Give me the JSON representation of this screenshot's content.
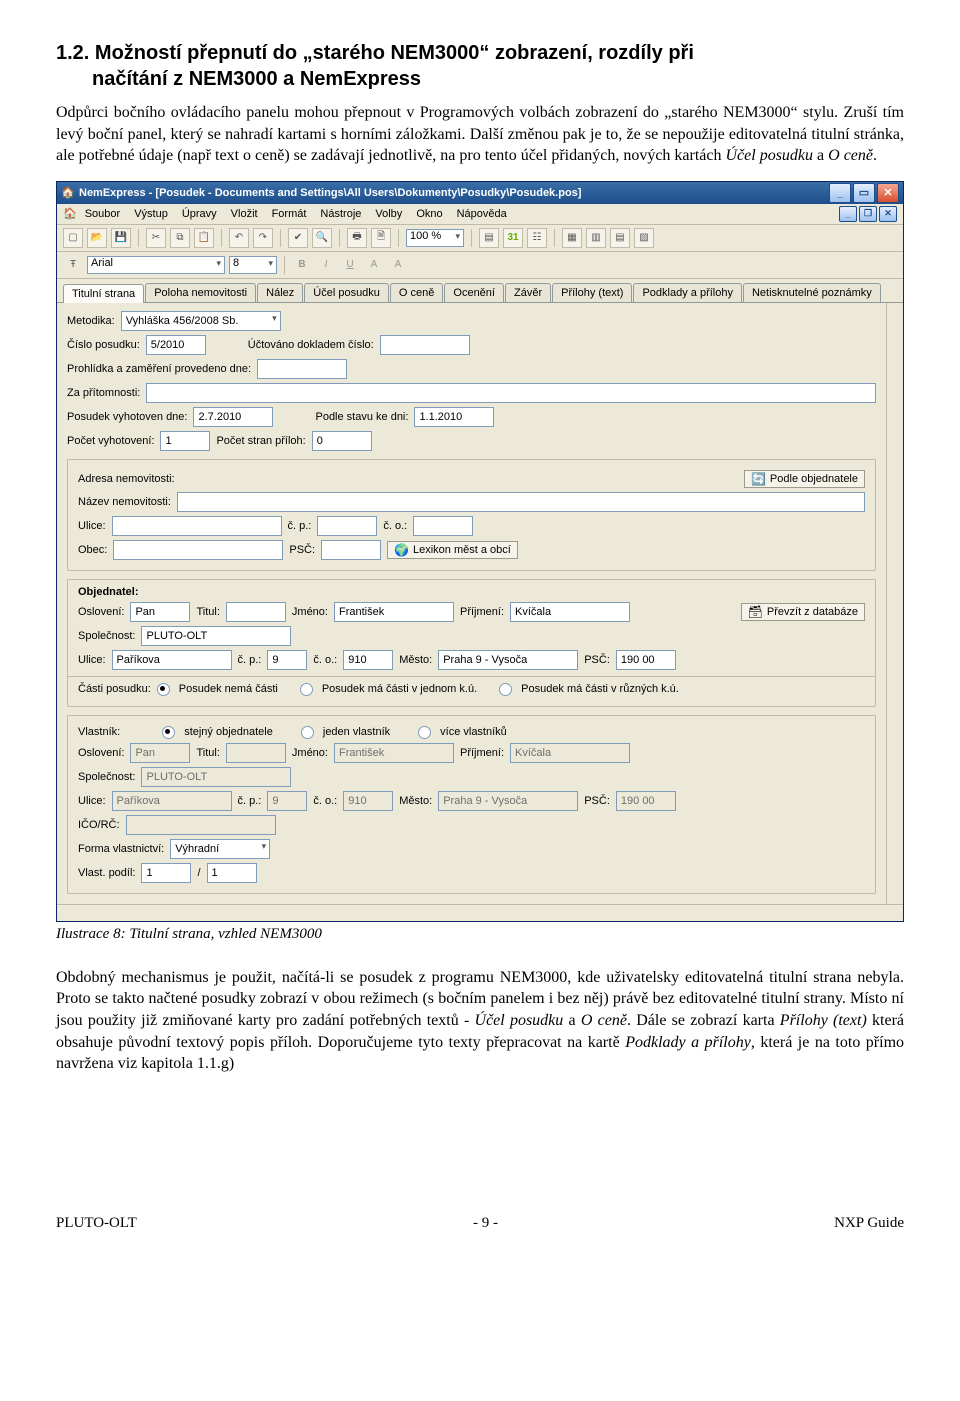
{
  "heading": {
    "number": "1.2.",
    "line1": "Možností přepnutí do „starého NEM3000“ zobrazení, rozdíly při",
    "line2": "načítání z NEM3000 a NemExpress"
  },
  "para1": "Odpůrci bočního ovládacího panelu mohou přepnout v Programových volbách zobrazení do „starého NEM3000“ stylu. Zruší tím levý boční panel, který se nahradí kartami s horními záložkami. Další změnou pak je to, že se nepoužije editovatelná titulní stránka, ale potřebné údaje (např text o ceně) se zadávají jednotlivě, na pro tento účel přidaných, nových kartách ",
  "para1_it1": "Účel posudku",
  "para1_mid": " a ",
  "para1_it2": "O ceně",
  "para1_end": ".",
  "caption": "Ilustrace 8: Titulní strana, vzhled NEM3000",
  "para2a": "Obdobný mechanismus je použit, načítá-li se posudek z programu NEM3000, kde uživatelsky editovatelná titulní strana nebyla. Proto se takto načtené posudky zobrazí v obou režimech (s bočním panelem i bez něj) právě bez editovatelné titulní strany. Místo ní jsou použity již zmiňované karty pro zadání potřebných textů - ",
  "para2_it1": "Účel posudku",
  "para2b": " a ",
  "para2_it2": "O ceně",
  "para2c": ". Dále se zobrazí karta ",
  "para2_it3": "Přílohy (text)",
  "para2d": " která obsahuje původní textový popis příloh. Doporučujeme tyto texty přepracovat na kartě ",
  "para2_it4": "Podklady a přílohy",
  "para2e": ", která je na toto přímo navržena viz kapitola  1.1.g)",
  "footer": {
    "left": "PLUTO-OLT",
    "center": "- 9 -",
    "right": "NXP Guide"
  },
  "app": {
    "title": "NemExpress - [Posudek - Documents and Settings\\All Users\\Dokumenty\\Posudky\\Posudek.pos]",
    "menus": [
      "Soubor",
      "Výstup",
      "Úpravy",
      "Vložit",
      "Formát",
      "Nástroje",
      "Volby",
      "Okno",
      "Nápověda"
    ],
    "font": "Arial",
    "fontsize": "8",
    "zoom": "100 %",
    "tabs": [
      "Titulní strana",
      "Poloha nemovitosti",
      "Nález",
      "Účel posudku",
      "O ceně",
      "Ocenění",
      "Závěr",
      "Přílohy (text)",
      "Podklady a přílohy",
      "Netisknutelné poznámky"
    ],
    "metodika_lbl": "Metodika:",
    "metodika": "Vyhláška 456/2008 Sb.",
    "cislo_lbl": "Číslo posudku:",
    "cislo": "5/2010",
    "uctovano_lbl": "Účtováno dokladem číslo:",
    "prohlidka_lbl": "Prohlídka a zaměření provedeno dne:",
    "zapritom_lbl": "Za přítomnosti:",
    "vyhotoven_lbl": "Posudek vyhotoven dne:",
    "vyhotoven": "2.7.2010",
    "stav_lbl": "Podle stavu ke dni:",
    "stav": "1.1.2010",
    "pocetvyh_lbl": "Počet vyhotovení:",
    "pocetvyh": "1",
    "pocetstran_lbl": "Počet stran příloh:",
    "pocetstran": "0",
    "adresa_title": "Adresa nemovitosti:",
    "nazev_lbl": "Název nemovitosti:",
    "ulice_lbl": "Ulice:",
    "cp_lbl": "č. p.:",
    "co_lbl": "č. o.:",
    "obec_lbl": "Obec:",
    "psc_lbl": "PSČ:",
    "podle_btn": "Podle objednatele",
    "lexikon_btn": "Lexikon měst a obcí",
    "obj_title": "Objednatel:",
    "osloveni_lbl": "Oslovení:",
    "osloveni": "Pan",
    "titul_lbl": "Titul:",
    "jmeno_lbl": "Jméno:",
    "jmeno": "František",
    "prijmeni_lbl": "Příjmení:",
    "prijmeni": "Kvíčala",
    "prevzit_btn": "Převzít z databáze",
    "spolecnost_lbl": "Společnost:",
    "spolecnost": "PLUTO-OLT",
    "obj_ulice": "Paříkova",
    "obj_cp": "9",
    "obj_co": "910",
    "mesto_lbl": "Město:",
    "obj_mesto": "Praha 9 - Vysoča",
    "obj_psc": "190 00",
    "casti_lbl": "Části posudku:",
    "casti_r1": "Posudek nemá části",
    "casti_r2": "Posudek má části v jednom k.ú.",
    "casti_r3": "Posudek má části v různých k.ú.",
    "vlastnik_title": "Vlastník:",
    "vl_r1": "stejný objednatele",
    "vl_r2": "jeden vlastník",
    "vl_r3": "více vlastníků",
    "vl_osloveni": "Pan",
    "vl_jmeno": "František",
    "vl_prijmeni": "Kvíčala",
    "vl_spol": "PLUTO-OLT",
    "vl_ulice": "Paříkova",
    "vl_cp": "9",
    "vl_co": "910",
    "vl_mesto": "Praha 9 - Vysoča",
    "vl_psc": "190 00",
    "ico_lbl": "IČO/RČ:",
    "forma_lbl": "Forma vlastnictví:",
    "forma": "Výhradní",
    "podil_lbl": "Vlast. podíl:",
    "podil_a": "1",
    "podil_b": "1"
  }
}
